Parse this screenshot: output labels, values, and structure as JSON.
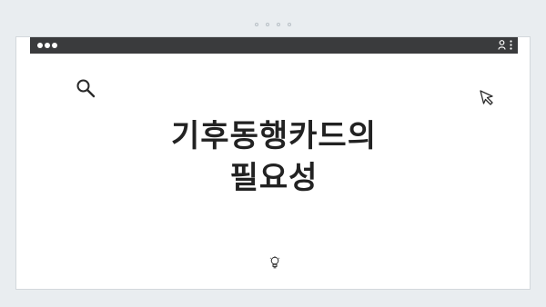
{
  "title": {
    "line1": "기후동행카드의",
    "line2": "필요성"
  },
  "page_indicator": {
    "count": 4
  },
  "icons": {
    "window_controls": "window-dots-icon",
    "user": "user-icon",
    "more": "more-vertical-icon",
    "search": "search-icon",
    "cursor": "cursor-arrow-icon",
    "idea": "lightbulb-icon"
  },
  "colors": {
    "background": "#e9edf0",
    "titlebar": "#3a3b3d",
    "card": "#ffffff",
    "text": "#222222"
  }
}
